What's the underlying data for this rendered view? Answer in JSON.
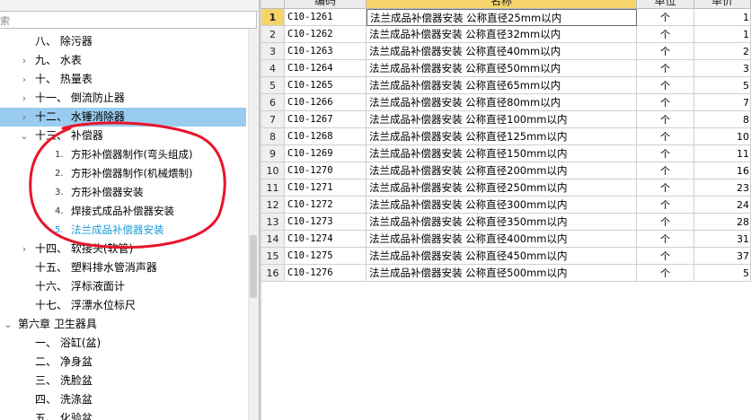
{
  "tree": {
    "search_placeholder": "索",
    "items": [
      {
        "label": "八、 除污器",
        "indent": 1,
        "expand": "none"
      },
      {
        "label": "九、 水表",
        "indent": 1,
        "expand": "collapsed"
      },
      {
        "label": "十、 热量表",
        "indent": 1,
        "expand": "collapsed"
      },
      {
        "label": "十一、 倒流防止器",
        "indent": 1,
        "expand": "collapsed"
      },
      {
        "label": "十二、 水锤消除器",
        "indent": 1,
        "expand": "collapsed",
        "selected": true
      },
      {
        "label": "十三、 补偿器",
        "indent": 1,
        "expand": "expanded"
      },
      {
        "num": "1.",
        "label": "方形补偿器制作(弯头组成)",
        "indent": 2
      },
      {
        "num": "2.",
        "label": "方形补偿器制作(机械煨制)",
        "indent": 2
      },
      {
        "num": "3.",
        "label": "方形补偿器安装",
        "indent": 2
      },
      {
        "num": "4.",
        "label": "焊接式成品补偿器安装",
        "indent": 2
      },
      {
        "num": "5.",
        "label": "法兰成品补偿器安装",
        "indent": 2,
        "current": true
      },
      {
        "label": "十四、 软接头(软管)",
        "indent": 1,
        "expand": "collapsed"
      },
      {
        "label": "十五、 塑料排水管消声器",
        "indent": 1,
        "expand": "none"
      },
      {
        "label": "十六、 浮标液面计",
        "indent": 1,
        "expand": "none"
      },
      {
        "label": "十七、 浮漂水位标尺",
        "indent": 1,
        "expand": "none"
      },
      {
        "label": "第六章 卫生器具",
        "indent": 0,
        "expand": "expanded"
      },
      {
        "label": "一、 浴缸(盆)",
        "indent": 1,
        "expand": "none"
      },
      {
        "label": "二、 净身盆",
        "indent": 1,
        "expand": "none"
      },
      {
        "label": "三、 洗脸盆",
        "indent": 1,
        "expand": "none"
      },
      {
        "label": "四、 洗涤盆",
        "indent": 1,
        "expand": "none"
      },
      {
        "label": "五、 化验盆",
        "indent": 1,
        "expand": "none"
      }
    ]
  },
  "grid": {
    "headers": [
      "",
      "编码",
      "名称",
      "单位",
      "单价"
    ],
    "rows": [
      {
        "n": "1",
        "code": "C10-1261",
        "name": "法兰成品补偿器安装 公称直径25mm以内",
        "unit": "个",
        "qty": "1"
      },
      {
        "n": "2",
        "code": "C10-1262",
        "name": "法兰成品补偿器安装 公称直径32mm以内",
        "unit": "个",
        "qty": "1"
      },
      {
        "n": "3",
        "code": "C10-1263",
        "name": "法兰成品补偿器安装 公称直径40mm以内",
        "unit": "个",
        "qty": "2"
      },
      {
        "n": "4",
        "code": "C10-1264",
        "name": "法兰成品补偿器安装 公称直径50mm以内",
        "unit": "个",
        "qty": "3"
      },
      {
        "n": "5",
        "code": "C10-1265",
        "name": "法兰成品补偿器安装 公称直径65mm以内",
        "unit": "个",
        "qty": "5"
      },
      {
        "n": "6",
        "code": "C10-1266",
        "name": "法兰成品补偿器安装 公称直径80mm以内",
        "unit": "个",
        "qty": "7"
      },
      {
        "n": "7",
        "code": "C10-1267",
        "name": "法兰成品补偿器安装 公称直径100mm以内",
        "unit": "个",
        "qty": "8"
      },
      {
        "n": "8",
        "code": "C10-1268",
        "name": "法兰成品补偿器安装 公称直径125mm以内",
        "unit": "个",
        "qty": "10"
      },
      {
        "n": "9",
        "code": "C10-1269",
        "name": "法兰成品补偿器安装 公称直径150mm以内",
        "unit": "个",
        "qty": "11"
      },
      {
        "n": "10",
        "code": "C10-1270",
        "name": "法兰成品补偿器安装 公称直径200mm以内",
        "unit": "个",
        "qty": "16"
      },
      {
        "n": "11",
        "code": "C10-1271",
        "name": "法兰成品补偿器安装 公称直径250mm以内",
        "unit": "个",
        "qty": "23"
      },
      {
        "n": "12",
        "code": "C10-1272",
        "name": "法兰成品补偿器安装 公称直径300mm以内",
        "unit": "个",
        "qty": "24"
      },
      {
        "n": "13",
        "code": "C10-1273",
        "name": "法兰成品补偿器安装 公称直径350mm以内",
        "unit": "个",
        "qty": "28"
      },
      {
        "n": "14",
        "code": "C10-1274",
        "name": "法兰成品补偿器安装 公称直径400mm以内",
        "unit": "个",
        "qty": "31"
      },
      {
        "n": "15",
        "code": "C10-1275",
        "name": "法兰成品补偿器安装 公称直径450mm以内",
        "unit": "个",
        "qty": "37"
      },
      {
        "n": "16",
        "code": "C10-1276",
        "name": "法兰成品补偿器安装 公称直径500mm以内",
        "unit": "个",
        "qty": "5"
      }
    ]
  },
  "colors": {
    "selected_bg": "#99ccf0",
    "current_text": "#1a9bd7",
    "active_header": "#f5d56b",
    "annotation": "#e8142a"
  }
}
